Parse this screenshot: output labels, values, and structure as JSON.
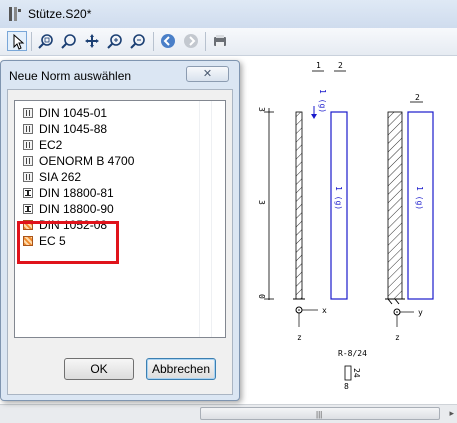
{
  "app": {
    "title": "Stütze.S20*",
    "toolbar": [
      "pointer-icon",
      "zoom-window-icon",
      "zoom-icon",
      "pan-icon",
      "zoom-in-icon",
      "zoom-out-icon",
      "back-icon",
      "forward-icon",
      "print-icon"
    ]
  },
  "drawing": {
    "left_top_labels": [
      "1",
      "2"
    ],
    "left_load_label": "1 (g)",
    "right_top_label": "2",
    "dim_ticks": [
      "3",
      "3",
      "0"
    ],
    "column_labels": [
      "1 (g)",
      "1 (g)"
    ],
    "axes_left": {
      "x": "x",
      "z": "z"
    },
    "axes_right": {
      "y": "y",
      "z": "z"
    },
    "section_label": "R-8/24",
    "section_dims": [
      "24",
      "8"
    ]
  },
  "dialog": {
    "title": "Neue Norm auswählen",
    "close_label": "✕",
    "items": [
      {
        "label": "DIN 1045-01",
        "icon": "steel"
      },
      {
        "label": "DIN 1045-88",
        "icon": "steel"
      },
      {
        "label": "EC2",
        "icon": "steel"
      },
      {
        "label": "OENORM B 4700",
        "icon": "steel"
      },
      {
        "label": "SIA 262",
        "icon": "steel"
      },
      {
        "label": "DIN 18800-81",
        "icon": "ibeam"
      },
      {
        "label": "DIN 18800-90",
        "icon": "ibeam"
      },
      {
        "label": "DIN 1052-08",
        "icon": "wood"
      },
      {
        "label": "EC 5",
        "icon": "wood"
      }
    ],
    "ok_label": "OK",
    "cancel_label": "Abbrechen"
  },
  "colors": {
    "highlight": "#e0131b",
    "load": "#1a1acc",
    "wood_icon": "#f08a2c"
  },
  "scrollbar": {
    "grip": "|||"
  }
}
